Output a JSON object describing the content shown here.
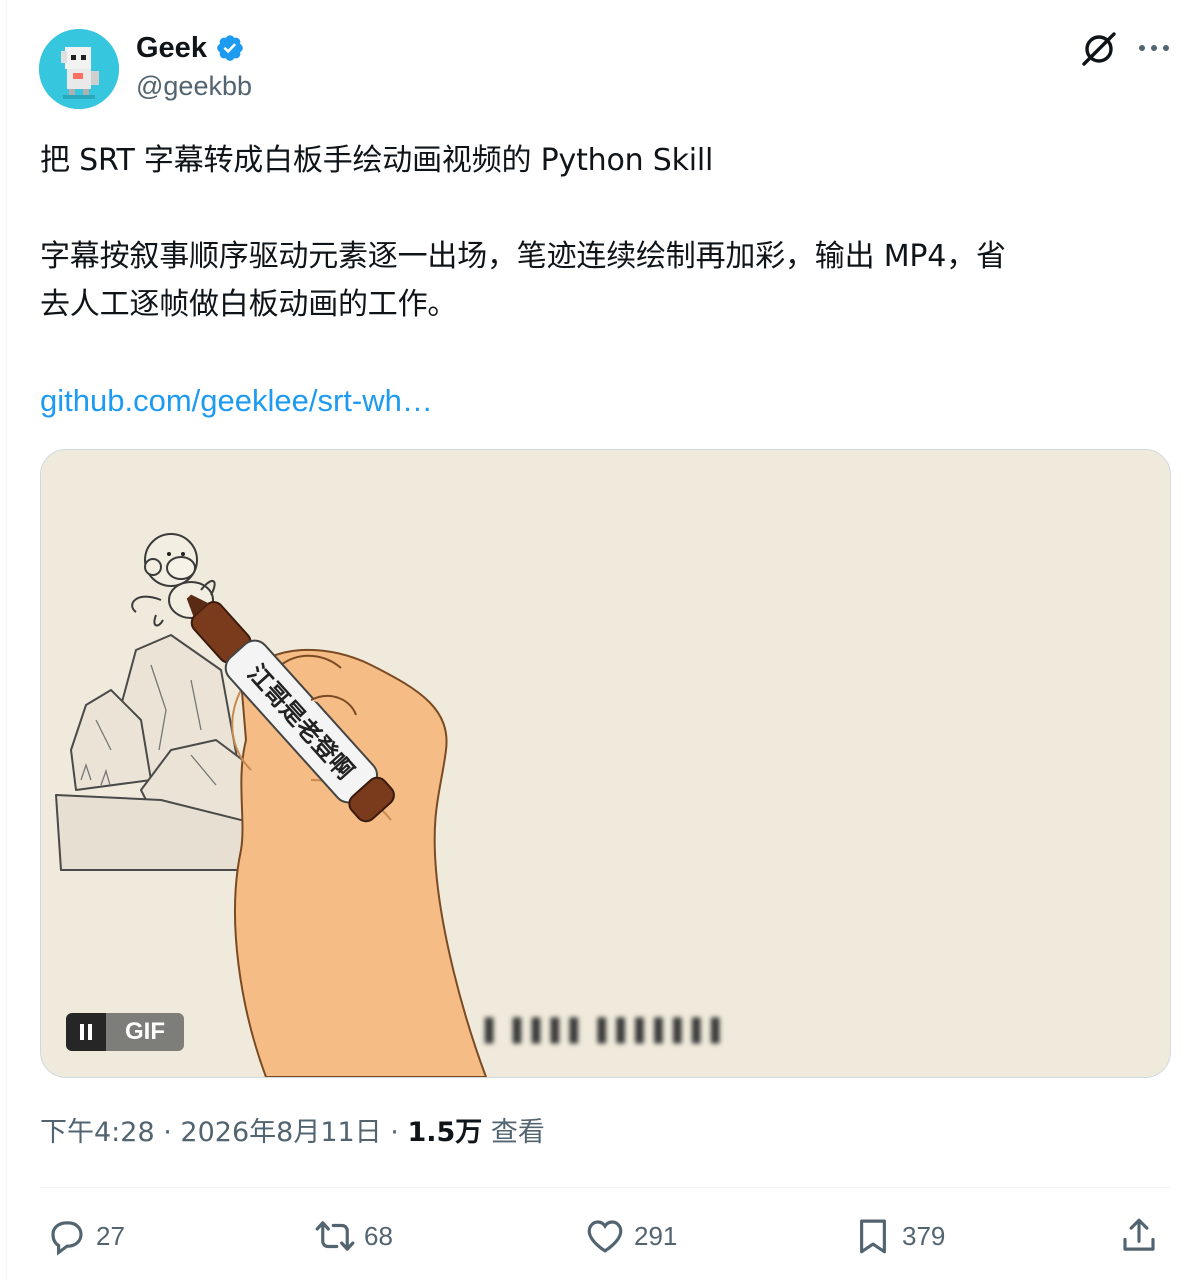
{
  "author": {
    "name": "Geek",
    "handle": "@geekbb",
    "verified": true,
    "avatar_icon": "pixel-robot-avatar",
    "avatar_bg": "#36c6dd"
  },
  "post": {
    "line1": "把 SRT 字幕转成白板手绘动画视频的 Python Skill",
    "line2": "字幕按叙事顺序驱动元素逐一出场，笔迹连续绘制再加彩，输出 MP4，省",
    "line3": "去人工逐帧做白板动画的工作。",
    "link": "github.com/geeklee/srt-wh…"
  },
  "media": {
    "type": "GIF",
    "gif_label": "GIF",
    "marker_text": "江哥是老登啊",
    "caption_blurred": "▌ ▌▌▌▌ ▌▌▌▌▌▌▌",
    "background": "#efeadb"
  },
  "meta": {
    "time": "下午4:28",
    "dot1": "·",
    "date": "2026年8月11日",
    "dot2": "·",
    "views": "1.5万",
    "views_label": "查看"
  },
  "actions": {
    "replies": "27",
    "reposts": "68",
    "likes": "291",
    "bookmarks": "379"
  },
  "colors": {
    "link": "#1d9bf0",
    "secondary_text": "#536471",
    "verified_badge": "#1d9bf0"
  }
}
